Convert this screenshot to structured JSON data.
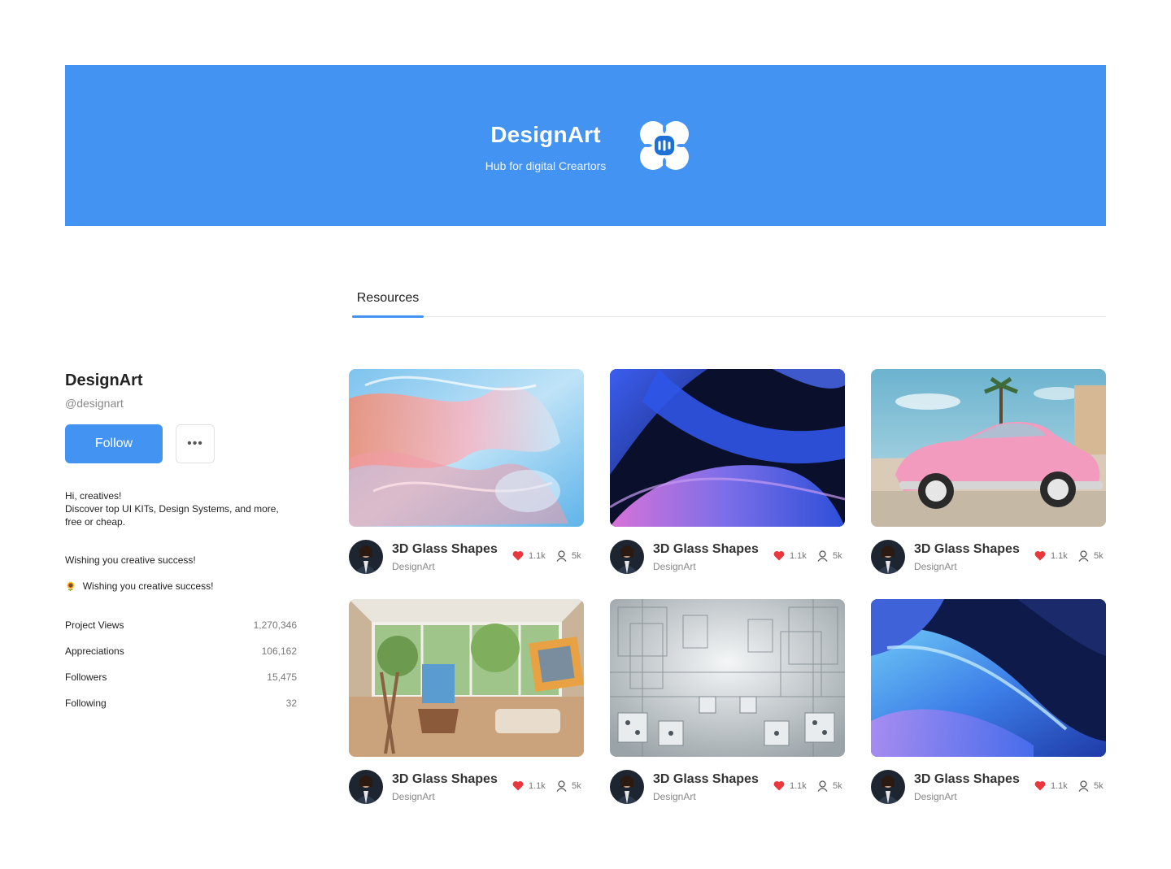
{
  "banner": {
    "title": "DesignArt",
    "subtitle": "Hub for digital Creartors",
    "logo_icon": "designart-logo-icon",
    "color": "#4393f3"
  },
  "tabs": [
    {
      "label": "Resources",
      "active": true
    }
  ],
  "profile": {
    "name": "DesignArt",
    "handle": "@designart",
    "follow_label": "Follow",
    "more_label": "•••",
    "bio_lines": [
      "Hi, creatives!",
      "Discover top UI KITs, Design Systems, and more,",
      "free or cheap."
    ],
    "wish_1": "Wishing you creative success!",
    "wish_2": "Wishing you creative success!",
    "wish_2_icon": "sunflower-icon"
  },
  "stats": [
    {
      "label": "Project Views",
      "value": "1,270,346"
    },
    {
      "label": "Appreciations",
      "value": "106,162"
    },
    {
      "label": "Followers",
      "value": "15,475"
    },
    {
      "label": "Following",
      "value": "32"
    }
  ],
  "cards": [
    {
      "title": "3D Glass Shapes",
      "author": "DesignArt",
      "likes": "1.1k",
      "views": "5k",
      "image": "glass-ribbons"
    },
    {
      "title": "3D Glass Shapes",
      "author": "DesignArt",
      "likes": "1.1k",
      "views": "5k",
      "image": "dark-waves"
    },
    {
      "title": "3D Glass Shapes",
      "author": "DesignArt",
      "likes": "1.1k",
      "views": "5k",
      "image": "pink-car"
    },
    {
      "title": "3D Glass Shapes",
      "author": "DesignArt",
      "likes": "1.1k",
      "views": "5k",
      "image": "art-studio"
    },
    {
      "title": "3D Glass Shapes",
      "author": "DesignArt",
      "likes": "1.1k",
      "views": "5k",
      "image": "white-city"
    },
    {
      "title": "3D Glass Shapes",
      "author": "DesignArt",
      "likes": "1.1k",
      "views": "5k",
      "image": "blue-waves"
    }
  ],
  "colors": {
    "accent": "#4393f3",
    "heart": "#e8383d"
  }
}
